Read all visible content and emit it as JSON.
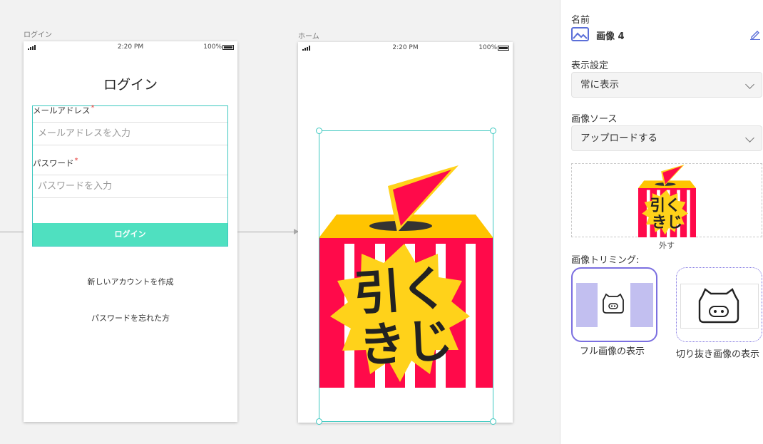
{
  "canvas": {
    "login_frame_label": "ログイン",
    "home_frame_label": "ホーム",
    "statusbar": {
      "time": "2:20 PM",
      "battery": "100%"
    },
    "login": {
      "title": "ログイン",
      "email_label": "メールアドレス",
      "email_placeholder": "メールアドレスを入力",
      "password_label": "パスワード",
      "password_placeholder": "パスワードを入力",
      "required_mark": "*",
      "login_button": "ログイン",
      "create_account_link": "新しいアカウントを作成",
      "forgot_password_link": "パスワードを忘れた方"
    },
    "home": {
      "lottery_text_line1": "引く",
      "lottery_text_line2": "きじ"
    }
  },
  "panel": {
    "name_label": "名前",
    "name_value": "画像 4",
    "visibility_label": "表示設定",
    "visibility_value": "常に表示",
    "source_label": "画像ソース",
    "source_value": "アップロードする",
    "remove_label": "外す",
    "trimming_label": "画像トリミング:",
    "trim_full_label": "フル画像の表示",
    "trim_crop_label": "切り抜き画像の表示"
  },
  "colors": {
    "accent_teal": "#4fe0c0",
    "selection": "#3cc8c0",
    "purple": "#7b6fe0",
    "lottery_red": "#ff0a4a",
    "lottery_yellow": "#ffd21a"
  }
}
